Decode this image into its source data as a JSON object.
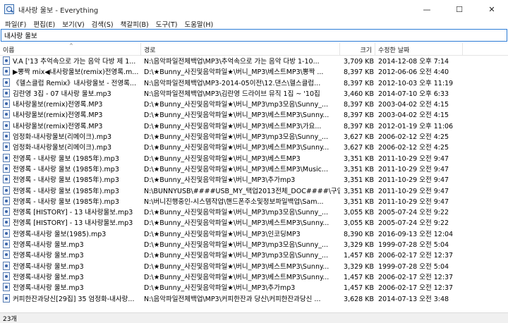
{
  "window": {
    "title": "내사랑 울보 - Everything",
    "minimize": "—",
    "maximize": "☐",
    "close": "✕"
  },
  "menu": [
    "파일(F)",
    "편집(E)",
    "보기(V)",
    "검색(S)",
    "책갈피(B)",
    "도구(T)",
    "도움말(H)"
  ],
  "search": {
    "value": "내사랑 울보"
  },
  "columns": {
    "name": "이름",
    "path": "경로",
    "size": "크기",
    "date": "수정한 날짜"
  },
  "rows": [
    {
      "name": "V.A ['13 추억속으로 가는 음악 다방 제 1...",
      "path": "N:\\음악파일전체백업\\MP3\\추억속으로 가는 음악 다방 1-10...",
      "size": "3,709 KB",
      "date": "2014-12-08 오후 7:14"
    },
    {
      "name": "▶뽕짝 mix◀내사랑울보(remix)전영록.m...",
      "path": "D:\\★Bunny_사진및음악파일★\\버니_MP3\\베스트MP3\\뽕짝 ...",
      "size": "8,397 KB",
      "date": "2012-06-06 오전 4:40"
    },
    {
      "name": "《헬스클럽 Remix》내사랑울보 - 전영록...",
      "path": "N:\\음악파일전체백업\\MP3-2014-05이전\\12.댄스\\헬스클럽...",
      "size": "8,397 KB",
      "date": "2012-10-03 오후 11:19"
    },
    {
      "name": "김란영 3집 - 07 내사랑 울보.mp3",
      "path": "N:\\음악파일전체백업\\MP3\\김란영 드라이브 뮤직 1집 ~ '10집",
      "size": "3,460 KB",
      "date": "2014-07-10 오후 6:33"
    },
    {
      "name": "내사랑울보(remix)전영록.MP3",
      "path": "D:\\★Bunny_사진및음악파일★\\버니_MP3\\mp3모음\\Sunny_...",
      "size": "8,397 KB",
      "date": "2003-04-02 오전 4:15"
    },
    {
      "name": "내사랑울보(remix)전영록.MP3",
      "path": "D:\\★Bunny_사진및음악파일★\\버니_MP3\\베스트MP3\\Sunny...",
      "size": "8,397 KB",
      "date": "2003-04-02 오전 4:15"
    },
    {
      "name": "내사랑울보(remix)전영록.MP3",
      "path": "D:\\★Bunny_사진및음악파일★\\버니_MP3\\베스트MP3\\가요...",
      "size": "8,397 KB",
      "date": "2012-01-19 오후 11:06"
    },
    {
      "name": "엄정화-내사랑울보(리메이크).mp3",
      "path": "D:\\★Bunny_사진및음악파일★\\버니_MP3\\mp3모음\\Sunny_...",
      "size": "3,627 KB",
      "date": "2006-02-12 오전 4:25"
    },
    {
      "name": "엄정화-내사랑울보(리메이크).mp3",
      "path": "D:\\★Bunny_사진및음악파일★\\버니_MP3\\베스트MP3\\Sunny...",
      "size": "3,627 KB",
      "date": "2006-02-12 오전 4:25"
    },
    {
      "name": "전영록 - 내사랑 울보 (1985年).mp3",
      "path": "D:\\★Bunny_사진및음악파일★\\버니_MP3\\베스트MP3",
      "size": "3,351 KB",
      "date": "2011-10-29 오전 9:47"
    },
    {
      "name": "전영록 - 내사랑 울보 (1985年).mp3",
      "path": "D:\\★Bunny_사진및음악파일★\\버니_MP3\\베스트MP3\\Music...",
      "size": "3,351 KB",
      "date": "2011-10-29 오전 9:47"
    },
    {
      "name": "전영록 - 내사랑 울보 (1985年).mp3",
      "path": "D:\\★Bunny_사진및음악파일★\\버니_MP3\\추가mp3",
      "size": "3,351 KB",
      "date": "2011-10-29 오전 9:47"
    },
    {
      "name": "전영록 - 내사랑 울보 (1985年).mp3",
      "path": "N:\\BUNNYUSB\\####USB_MY_택업2013전체_DOC####\\구입...",
      "size": "3,351 KB",
      "date": "2011-10-29 오전 9:47"
    },
    {
      "name": "전영록 - 내사랑 울보 (1985年).mp3",
      "path": "N:\\버니진행중인-시스템작업\\핸드폰주소및정보파일백업\\Sam...",
      "size": "3,351 KB",
      "date": "2011-10-29 오전 9:47"
    },
    {
      "name": "전영록 [HISTORY] - 13 내사랑울보.mp3",
      "path": "D:\\★Bunny_사진및음악파일★\\버니_MP3\\mp3모음\\Sunny_...",
      "size": "3,055 KB",
      "date": "2005-07-24 오전 9:22"
    },
    {
      "name": "전영록 [HISTORY] - 13 내사랑울보.mp3",
      "path": "D:\\★Bunny_사진및음악파일★\\버니_MP3\\베스트MP3\\Sunny...",
      "size": "3,055 KB",
      "date": "2005-07-24 오전 9:22"
    },
    {
      "name": "전영록-내사랑 울보(1985).mp3",
      "path": "D:\\★Bunny_사진및음악파일★\\버니_MP3\\인코딩MP3",
      "size": "8,390 KB",
      "date": "2016-09-13 오전 12:04"
    },
    {
      "name": "전영록-내사랑 울보.mp3",
      "path": "D:\\★Bunny_사진및음악파일★\\버니_MP3\\mp3모음\\Sunny_...",
      "size": "3,329 KB",
      "date": "1999-07-28 오전 5:04"
    },
    {
      "name": "전영록-내사랑 울보.mp3",
      "path": "D:\\★Bunny_사진및음악파일★\\버니_MP3\\mp3모음\\Sunny_...",
      "size": "1,457 KB",
      "date": "2006-02-17 오전 12:37"
    },
    {
      "name": "전영록-내사랑 울보.mp3",
      "path": "D:\\★Bunny_사진및음악파일★\\버니_MP3\\베스트MP3\\Sunny...",
      "size": "3,329 KB",
      "date": "1999-07-28 오전 5:04"
    },
    {
      "name": "전영록-내사랑 울보.mp3",
      "path": "D:\\★Bunny_사진및음악파일★\\버니_MP3\\베스트MP3\\Sunny...",
      "size": "1,457 KB",
      "date": "2006-02-17 오전 12:37"
    },
    {
      "name": "전영록-내사랑 울보.mp3",
      "path": "D:\\★Bunny_사진및음악파일★\\버니_MP3\\추가mp3",
      "size": "1,457 KB",
      "date": "2006-02-17 오전 12:37"
    },
    {
      "name": "커피한잔과당신[29집] 35 엄정화-내사랑...",
      "path": "N:\\음악파일전체백업\\MP3\\커피한잔과 당신\\커피한잔과당신 ...",
      "size": "3,628 KB",
      "date": "2014-07-13 오전 3:48"
    }
  ],
  "status": {
    "count": "23개"
  }
}
